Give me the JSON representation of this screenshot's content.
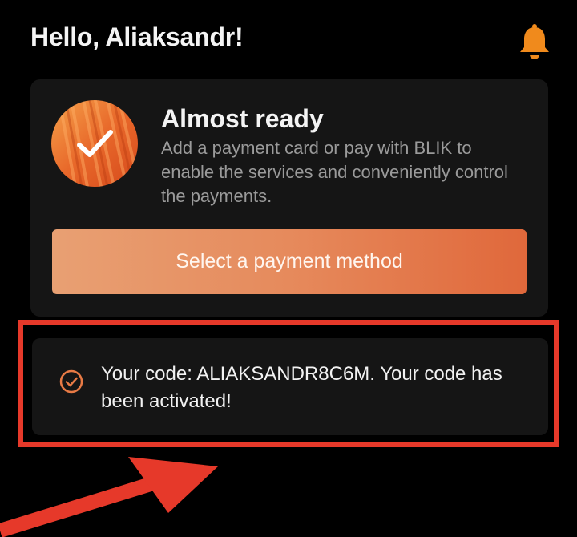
{
  "header": {
    "greeting": "Hello, Aliaksandr!",
    "notification_icon": "bell-icon"
  },
  "setup_card": {
    "avatar_icon": "checkmark-icon",
    "title": "Almost ready",
    "description": "Add a payment card or pay with BLIK to enable the services and conveniently control the payments.",
    "button_label": "Select a payment method"
  },
  "code_notice": {
    "icon": "check-circle-icon",
    "message": "Your code: ALIAKSANDR8C6M. Your code has been activated!"
  },
  "annotation": {
    "highlight_color": "#e6392a",
    "arrow_icon": "arrow-icon"
  },
  "colors": {
    "accent": "#f08a3c",
    "button_gradient_start": "#e8a073",
    "button_gradient_end": "#e0683b",
    "background": "#000000",
    "card": "#151515"
  }
}
